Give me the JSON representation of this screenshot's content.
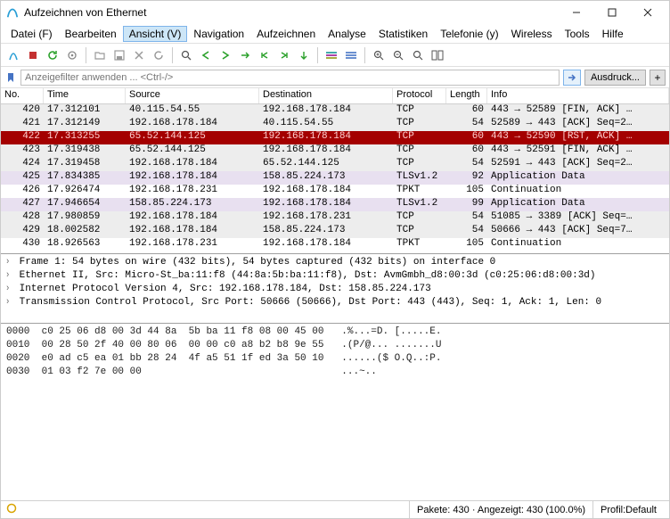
{
  "titlebar": {
    "title": "Aufzeichnen von Ethernet"
  },
  "menu": {
    "items": [
      "Datei (F)",
      "Bearbeiten",
      "Ansicht (V)",
      "Navigation",
      "Aufzeichnen",
      "Analyse",
      "Statistiken",
      "Telefonie (y)",
      "Wireless",
      "Tools",
      "Hilfe"
    ],
    "active_index": 2
  },
  "filter": {
    "placeholder": "Anzeigefilter anwenden ... <Ctrl-/>",
    "expr_label": "Ausdruck...",
    "plus_label": "+"
  },
  "columns": {
    "no": "No.",
    "time": "Time",
    "source": "Source",
    "destination": "Destination",
    "protocol": "Protocol",
    "length": "Length",
    "info": "Info"
  },
  "packets": [
    {
      "no": "420",
      "time": "17.312101",
      "src": "40.115.54.55",
      "dst": "192.168.178.184",
      "proto": "TCP",
      "len": "60",
      "info": "443 → 52589 [FIN, ACK] …",
      "cls": "gray"
    },
    {
      "no": "421",
      "time": "17.312149",
      "src": "192.168.178.184",
      "dst": "40.115.54.55",
      "proto": "TCP",
      "len": "54",
      "info": "52589 → 443 [ACK] Seq=2…",
      "cls": "gray"
    },
    {
      "no": "422",
      "time": "17.313255",
      "src": "65.52.144.125",
      "dst": "192.168.178.184",
      "proto": "TCP",
      "len": "60",
      "info": "443 → 52590 [RST, ACK] …",
      "cls": "red"
    },
    {
      "no": "423",
      "time": "17.319438",
      "src": "65.52.144.125",
      "dst": "192.168.178.184",
      "proto": "TCP",
      "len": "60",
      "info": "443 → 52591 [FIN, ACK] …",
      "cls": "gray"
    },
    {
      "no": "424",
      "time": "17.319458",
      "src": "192.168.178.184",
      "dst": "65.52.144.125",
      "proto": "TCP",
      "len": "54",
      "info": "52591 → 443 [ACK] Seq=2…",
      "cls": "gray"
    },
    {
      "no": "425",
      "time": "17.834385",
      "src": "192.168.178.184",
      "dst": "158.85.224.173",
      "proto": "TLSv1.2",
      "len": "92",
      "info": "Application Data",
      "cls": "purple"
    },
    {
      "no": "426",
      "time": "17.926474",
      "src": "192.168.178.231",
      "dst": "192.168.178.184",
      "proto": "TPKT",
      "len": "105",
      "info": "Continuation",
      "cls": "white"
    },
    {
      "no": "427",
      "time": "17.946654",
      "src": "158.85.224.173",
      "dst": "192.168.178.184",
      "proto": "TLSv1.2",
      "len": "99",
      "info": "Application Data",
      "cls": "purple"
    },
    {
      "no": "428",
      "time": "17.980859",
      "src": "192.168.178.184",
      "dst": "192.168.178.231",
      "proto": "TCP",
      "len": "54",
      "info": "51085 → 3389 [ACK] Seq=…",
      "cls": "gray"
    },
    {
      "no": "429",
      "time": "18.002582",
      "src": "192.168.178.184",
      "dst": "158.85.224.173",
      "proto": "TCP",
      "len": "54",
      "info": "50666 → 443 [ACK] Seq=7…",
      "cls": "gray"
    },
    {
      "no": "430",
      "time": "18.926563",
      "src": "192.168.178.231",
      "dst": "192.168.178.184",
      "proto": "TPKT",
      "len": "105",
      "info": "Continuation",
      "cls": "white"
    }
  ],
  "details": [
    "Frame 1: 54 bytes on wire (432 bits), 54 bytes captured (432 bits) on interface 0",
    "Ethernet II, Src: Micro-St_ba:11:f8 (44:8a:5b:ba:11:f8), Dst: AvmGmbh_d8:00:3d (c0:25:06:d8:00:3d)",
    "Internet Protocol Version 4, Src: 192.168.178.184, Dst: 158.85.224.173",
    "Transmission Control Protocol, Src Port: 50666 (50666), Dst Port: 443 (443), Seq: 1, Ack: 1, Len: 0"
  ],
  "hex": [
    {
      "off": "0000",
      "b": "c0 25 06 d8 00 3d 44 8a  5b ba 11 f8 08 00 45 00",
      "a": ".%...=D. [.....E."
    },
    {
      "off": "0010",
      "b": "00 28 50 2f 40 00 80 06  00 00 c0 a8 b2 b8 9e 55",
      "a": ".(P/@... .......U"
    },
    {
      "off": "0020",
      "b": "e0 ad c5 ea 01 bb 28 24  4f a5 51 1f ed 3a 50 10",
      "a": "......($ O.Q..:P."
    },
    {
      "off": "0030",
      "b": "01 03 f2 7e 00 00",
      "a": "...~.."
    }
  ],
  "status": {
    "packets": "Pakete: 430 · Angezeigt: 430 (100.0%)",
    "profile": "Profil:Default"
  }
}
